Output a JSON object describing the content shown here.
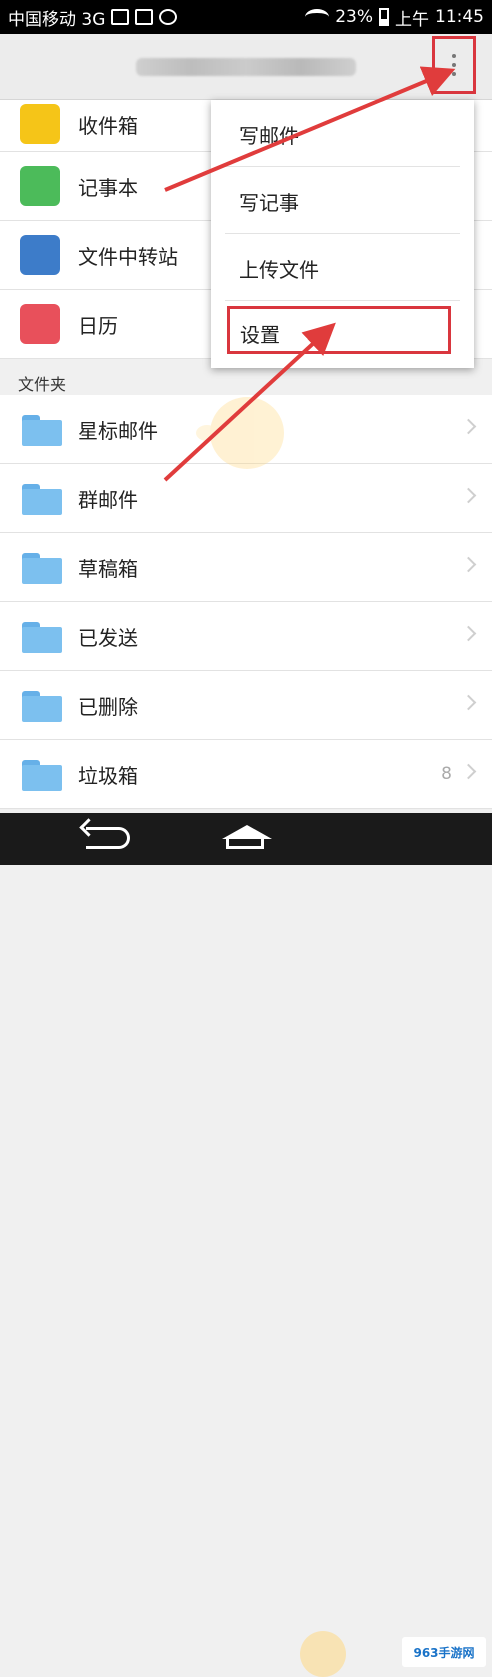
{
  "status_bar": {
    "carrier": "中国移动 3G",
    "battery": "23%",
    "time_prefix": "上午",
    "time": "11:45"
  },
  "apps": [
    {
      "label": "收件箱",
      "icon": "inbox-icon",
      "color": "#f5c518"
    },
    {
      "label": "记事本",
      "icon": "notepad-icon",
      "color": "#4cbb5a"
    },
    {
      "label": "文件中转站",
      "icon": "file-transfer-icon",
      "color": "#3d7cc9"
    },
    {
      "label": "日历",
      "icon": "calendar-icon",
      "color": "#e8505b"
    }
  ],
  "folders_section": "文件夹",
  "folders": [
    {
      "label": "星标邮件",
      "count": ""
    },
    {
      "label": "群邮件",
      "count": ""
    },
    {
      "label": "草稿箱",
      "count": ""
    },
    {
      "label": "已发送",
      "count": ""
    },
    {
      "label": "已删除",
      "count": ""
    },
    {
      "label": "垃圾箱",
      "count": "8"
    }
  ],
  "menu": {
    "items": [
      "写邮件",
      "写记事",
      "上传文件",
      "设置"
    ]
  },
  "watermark": "963手游网",
  "colors": {
    "highlight": "#d9363e",
    "folder": "#7cc0ef"
  }
}
